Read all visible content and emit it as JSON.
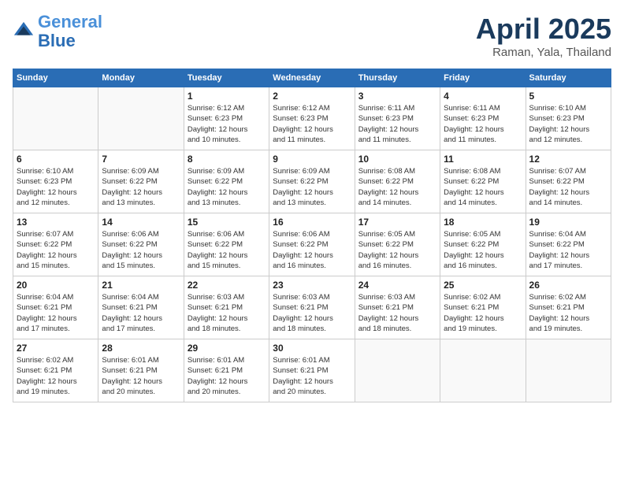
{
  "header": {
    "logo_line1": "General",
    "logo_line2": "Blue",
    "month": "April 2025",
    "location": "Raman, Yala, Thailand"
  },
  "weekdays": [
    "Sunday",
    "Monday",
    "Tuesday",
    "Wednesday",
    "Thursday",
    "Friday",
    "Saturday"
  ],
  "weeks": [
    [
      {
        "day": "",
        "info": ""
      },
      {
        "day": "",
        "info": ""
      },
      {
        "day": "1",
        "info": "Sunrise: 6:12 AM\nSunset: 6:23 PM\nDaylight: 12 hours\nand 10 minutes."
      },
      {
        "day": "2",
        "info": "Sunrise: 6:12 AM\nSunset: 6:23 PM\nDaylight: 12 hours\nand 11 minutes."
      },
      {
        "day": "3",
        "info": "Sunrise: 6:11 AM\nSunset: 6:23 PM\nDaylight: 12 hours\nand 11 minutes."
      },
      {
        "day": "4",
        "info": "Sunrise: 6:11 AM\nSunset: 6:23 PM\nDaylight: 12 hours\nand 11 minutes."
      },
      {
        "day": "5",
        "info": "Sunrise: 6:10 AM\nSunset: 6:23 PM\nDaylight: 12 hours\nand 12 minutes."
      }
    ],
    [
      {
        "day": "6",
        "info": "Sunrise: 6:10 AM\nSunset: 6:23 PM\nDaylight: 12 hours\nand 12 minutes."
      },
      {
        "day": "7",
        "info": "Sunrise: 6:09 AM\nSunset: 6:22 PM\nDaylight: 12 hours\nand 13 minutes."
      },
      {
        "day": "8",
        "info": "Sunrise: 6:09 AM\nSunset: 6:22 PM\nDaylight: 12 hours\nand 13 minutes."
      },
      {
        "day": "9",
        "info": "Sunrise: 6:09 AM\nSunset: 6:22 PM\nDaylight: 12 hours\nand 13 minutes."
      },
      {
        "day": "10",
        "info": "Sunrise: 6:08 AM\nSunset: 6:22 PM\nDaylight: 12 hours\nand 14 minutes."
      },
      {
        "day": "11",
        "info": "Sunrise: 6:08 AM\nSunset: 6:22 PM\nDaylight: 12 hours\nand 14 minutes."
      },
      {
        "day": "12",
        "info": "Sunrise: 6:07 AM\nSunset: 6:22 PM\nDaylight: 12 hours\nand 14 minutes."
      }
    ],
    [
      {
        "day": "13",
        "info": "Sunrise: 6:07 AM\nSunset: 6:22 PM\nDaylight: 12 hours\nand 15 minutes."
      },
      {
        "day": "14",
        "info": "Sunrise: 6:06 AM\nSunset: 6:22 PM\nDaylight: 12 hours\nand 15 minutes."
      },
      {
        "day": "15",
        "info": "Sunrise: 6:06 AM\nSunset: 6:22 PM\nDaylight: 12 hours\nand 15 minutes."
      },
      {
        "day": "16",
        "info": "Sunrise: 6:06 AM\nSunset: 6:22 PM\nDaylight: 12 hours\nand 16 minutes."
      },
      {
        "day": "17",
        "info": "Sunrise: 6:05 AM\nSunset: 6:22 PM\nDaylight: 12 hours\nand 16 minutes."
      },
      {
        "day": "18",
        "info": "Sunrise: 6:05 AM\nSunset: 6:22 PM\nDaylight: 12 hours\nand 16 minutes."
      },
      {
        "day": "19",
        "info": "Sunrise: 6:04 AM\nSunset: 6:22 PM\nDaylight: 12 hours\nand 17 minutes."
      }
    ],
    [
      {
        "day": "20",
        "info": "Sunrise: 6:04 AM\nSunset: 6:21 PM\nDaylight: 12 hours\nand 17 minutes."
      },
      {
        "day": "21",
        "info": "Sunrise: 6:04 AM\nSunset: 6:21 PM\nDaylight: 12 hours\nand 17 minutes."
      },
      {
        "day": "22",
        "info": "Sunrise: 6:03 AM\nSunset: 6:21 PM\nDaylight: 12 hours\nand 18 minutes."
      },
      {
        "day": "23",
        "info": "Sunrise: 6:03 AM\nSunset: 6:21 PM\nDaylight: 12 hours\nand 18 minutes."
      },
      {
        "day": "24",
        "info": "Sunrise: 6:03 AM\nSunset: 6:21 PM\nDaylight: 12 hours\nand 18 minutes."
      },
      {
        "day": "25",
        "info": "Sunrise: 6:02 AM\nSunset: 6:21 PM\nDaylight: 12 hours\nand 19 minutes."
      },
      {
        "day": "26",
        "info": "Sunrise: 6:02 AM\nSunset: 6:21 PM\nDaylight: 12 hours\nand 19 minutes."
      }
    ],
    [
      {
        "day": "27",
        "info": "Sunrise: 6:02 AM\nSunset: 6:21 PM\nDaylight: 12 hours\nand 19 minutes."
      },
      {
        "day": "28",
        "info": "Sunrise: 6:01 AM\nSunset: 6:21 PM\nDaylight: 12 hours\nand 20 minutes."
      },
      {
        "day": "29",
        "info": "Sunrise: 6:01 AM\nSunset: 6:21 PM\nDaylight: 12 hours\nand 20 minutes."
      },
      {
        "day": "30",
        "info": "Sunrise: 6:01 AM\nSunset: 6:21 PM\nDaylight: 12 hours\nand 20 minutes."
      },
      {
        "day": "",
        "info": ""
      },
      {
        "day": "",
        "info": ""
      },
      {
        "day": "",
        "info": ""
      }
    ]
  ]
}
